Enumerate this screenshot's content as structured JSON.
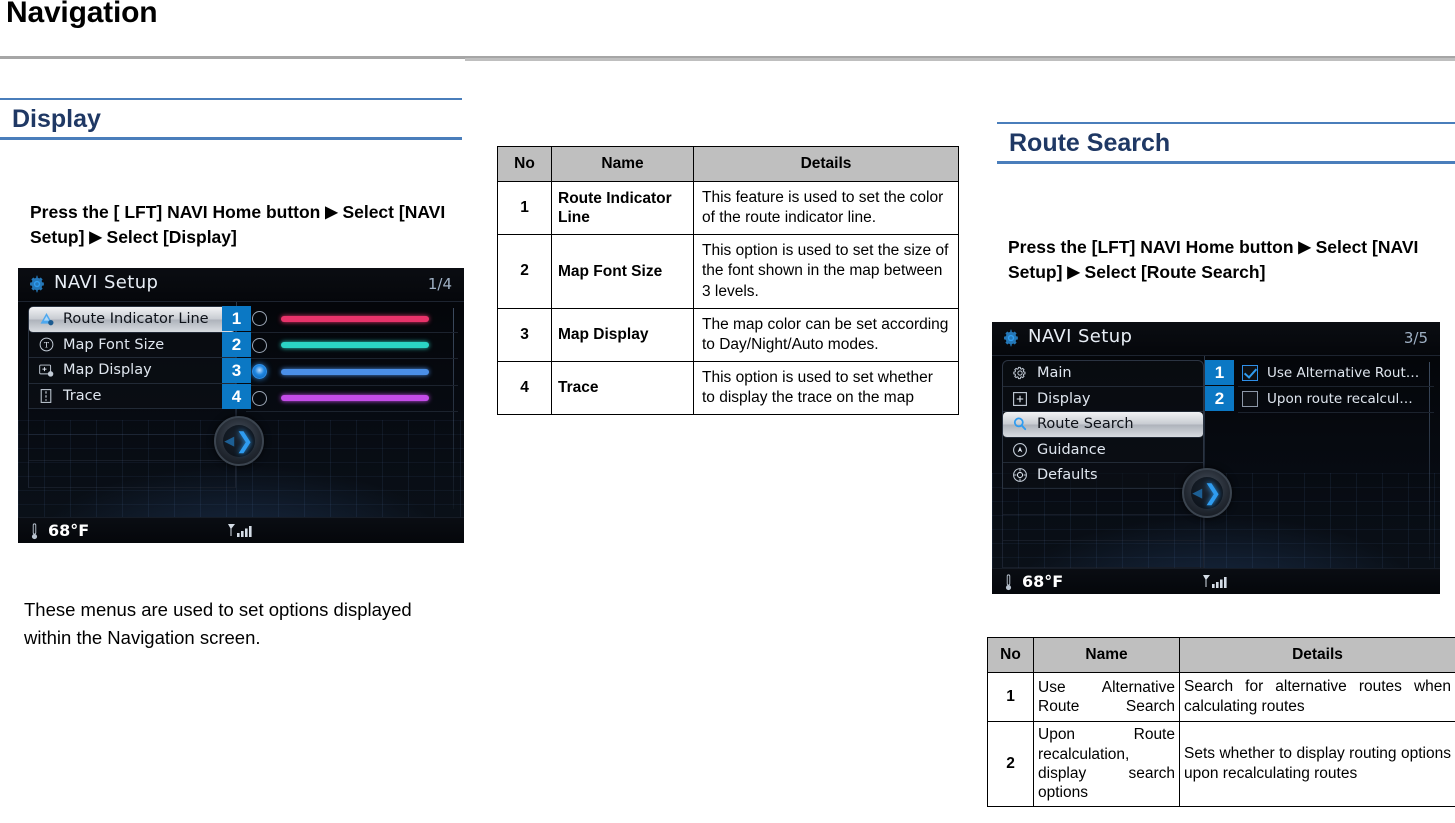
{
  "header": {
    "title": "Navigation"
  },
  "left_section": {
    "heading": "Display",
    "instruction": "Press the [ LFT] NAVI Home button  ▶  Select [NAVI Setup]  ▶  Select [Display]",
    "instruction_line1_a": "Press the [ LFT] NAVI Home button",
    "instruction_line1_b": "Select",
    "instruction_line2_a": "[NAVI Setup]",
    "instruction_line2_b": "Select [Display]",
    "paragraph": "These menus are used to set options displayed within the Navigation screen.",
    "device": {
      "title": "NAVI Setup",
      "page_indicator": "1/4",
      "temperature": "68°F",
      "menu_items": [
        {
          "label": "Route Indicator Line",
          "icon": "route-indicator-icon",
          "selected": true
        },
        {
          "label": "Map Font Size",
          "icon": "font-size-icon",
          "selected": false
        },
        {
          "label": "Map Display",
          "icon": "map-display-icon",
          "selected": false
        },
        {
          "label": "Trace",
          "icon": "trace-icon",
          "selected": false
        }
      ],
      "badges": [
        "1",
        "2",
        "3",
        "4"
      ],
      "color_options": [
        {
          "color": "#e8336a",
          "selected": false
        },
        {
          "color": "#2bd4c4",
          "selected": false
        },
        {
          "color": "#4a8fe8",
          "selected": true
        },
        {
          "color": "#c44ce8",
          "selected": false
        }
      ]
    },
    "table": {
      "columns": [
        "No",
        "Name",
        "Details"
      ],
      "rows": [
        {
          "no": "1",
          "name": "Route Indicator Line",
          "details": "This feature is used to set the color of the route indicator line."
        },
        {
          "no": "2",
          "name": "Map Font Size",
          "details": "This option is used to set the size of the font shown in the map between 3 levels."
        },
        {
          "no": "3",
          "name": "Map Display",
          "details": "The map color can be set according to Day/Night/Auto modes."
        },
        {
          "no": "4",
          "name": "Trace",
          "details": "This option is used to set whether to display the trace on the map"
        }
      ]
    }
  },
  "right_section": {
    "heading": "Route Search",
    "instruction_line1_a": "Press the [LFT] NAVI Home button",
    "instruction_line1_b": "Select",
    "instruction_line2_a": "[NAVI Setup]",
    "instruction_line2_b": "Select [Route Search]",
    "device": {
      "title": "NAVI Setup",
      "page_indicator": "3/5",
      "temperature": "68°F",
      "menu_items": [
        {
          "label": "Main",
          "icon": "gear-icon",
          "selected": false
        },
        {
          "label": "Display",
          "icon": "plus-box-icon",
          "selected": false
        },
        {
          "label": "Route Search",
          "icon": "magnifier-icon",
          "selected": true
        },
        {
          "label": "Guidance",
          "icon": "compass-icon",
          "selected": false
        },
        {
          "label": "Defaults",
          "icon": "settings-reset-icon",
          "selected": false
        }
      ],
      "badges": [
        "1",
        "2"
      ],
      "checkbox_options": [
        {
          "label": "Use Alternative Rout…",
          "checked": true
        },
        {
          "label": "Upon route recalcul…",
          "checked": false
        }
      ]
    },
    "table": {
      "columns": [
        "No",
        "Name",
        "Details"
      ],
      "rows": [
        {
          "no": "1",
          "name": "Use  Alternative Route Search",
          "details": "Search for alternative routes when calculating routes"
        },
        {
          "no": "2",
          "name": " Upon         Route recalculation, display search options",
          "details": "Sets whether to display routing options upon recalculating routes"
        }
      ]
    }
  },
  "colors": {
    "heading_blue": "#1f3864",
    "rule_blue": "#4a7ebb",
    "badge_blue": "#0b78c4",
    "table_header_gray": "#bfbfbf",
    "header_rule_gray": "#a6a6a6"
  }
}
